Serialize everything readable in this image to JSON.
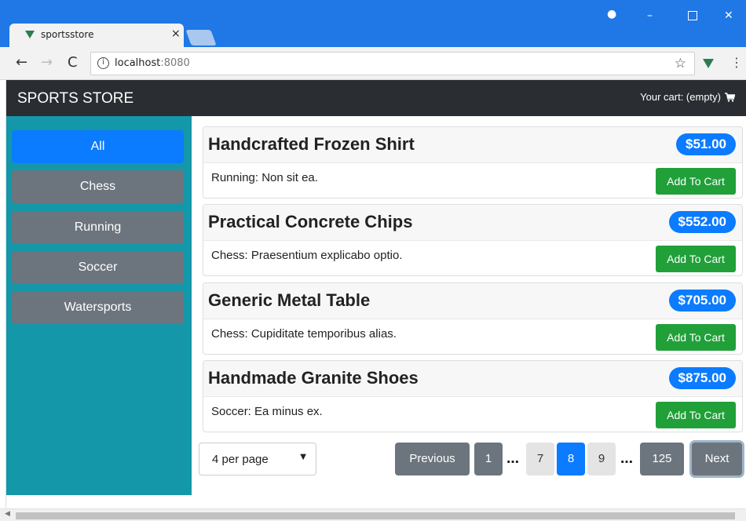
{
  "browser": {
    "tab_title": "sportsstore",
    "tab_close": "×",
    "url_host": "localhost",
    "url_port": ":8080",
    "back": "←",
    "forward": "→",
    "reload": "C",
    "star": "☆",
    "menu": "⋮",
    "minimize": "–",
    "close": "✕",
    "account": "●"
  },
  "header": {
    "brand": "SPORTS STORE",
    "cart_text": "Your cart: (empty)",
    "cart_icon": "shopping-cart-icon"
  },
  "categories": [
    {
      "label": "All",
      "active": true
    },
    {
      "label": "Chess",
      "active": false
    },
    {
      "label": "Running",
      "active": false
    },
    {
      "label": "Soccer",
      "active": false
    },
    {
      "label": "Watersports",
      "active": false
    }
  ],
  "products": [
    {
      "name": "Handcrafted Frozen Shirt",
      "price": "$51.00",
      "description": "Running: Non sit ea.",
      "button": "Add To Cart"
    },
    {
      "name": "Practical Concrete Chips",
      "price": "$552.00",
      "description": "Chess: Praesentium explicabo optio.",
      "button": "Add To Cart"
    },
    {
      "name": "Generic Metal Table",
      "price": "$705.00",
      "description": "Chess: Cupiditate temporibus alias.",
      "button": "Add To Cart"
    },
    {
      "name": "Handmade Granite Shoes",
      "price": "$875.00",
      "description": "Soccer: Ea minus ex.",
      "button": "Add To Cart"
    }
  ],
  "pagination": {
    "per_page": "4 per page",
    "previous": "Previous",
    "first": "1",
    "ellipsis": "…",
    "p7": "7",
    "p8": "8",
    "p9": "9",
    "last": "125",
    "next": "Next"
  },
  "colors": {
    "sidebar": "#1597aa",
    "primary": "#0b7bff",
    "success": "#21a03a",
    "secondary": "#6c757d",
    "header": "#2a2d31"
  }
}
